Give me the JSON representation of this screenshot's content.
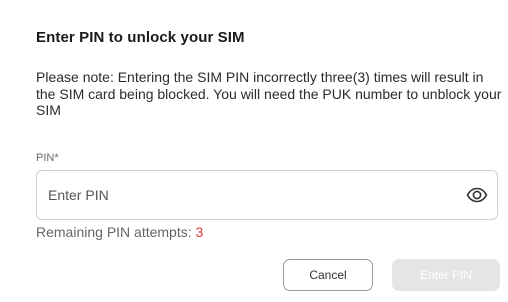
{
  "dialog": {
    "title": "Enter PIN to unlock your SIM",
    "note": "Please note: Entering the SIM PIN incorrectly three(3) times will result in the SIM card being blocked. You will need the PUK number to unblock your SIM",
    "pin_label": "PIN*",
    "pin_input": {
      "value": "",
      "placeholder": "Enter PIN"
    },
    "toggle_icon": "eye-icon",
    "attempts_label": "Remaining PIN attempts: ",
    "attempts_count": "3",
    "cancel_label": "Cancel",
    "enter_label": "Enter PIN"
  },
  "colors": {
    "attempts_count": "#e53935",
    "enter_button_disabled_bg": "#e5e5e5",
    "border": "#cfcfcf"
  }
}
